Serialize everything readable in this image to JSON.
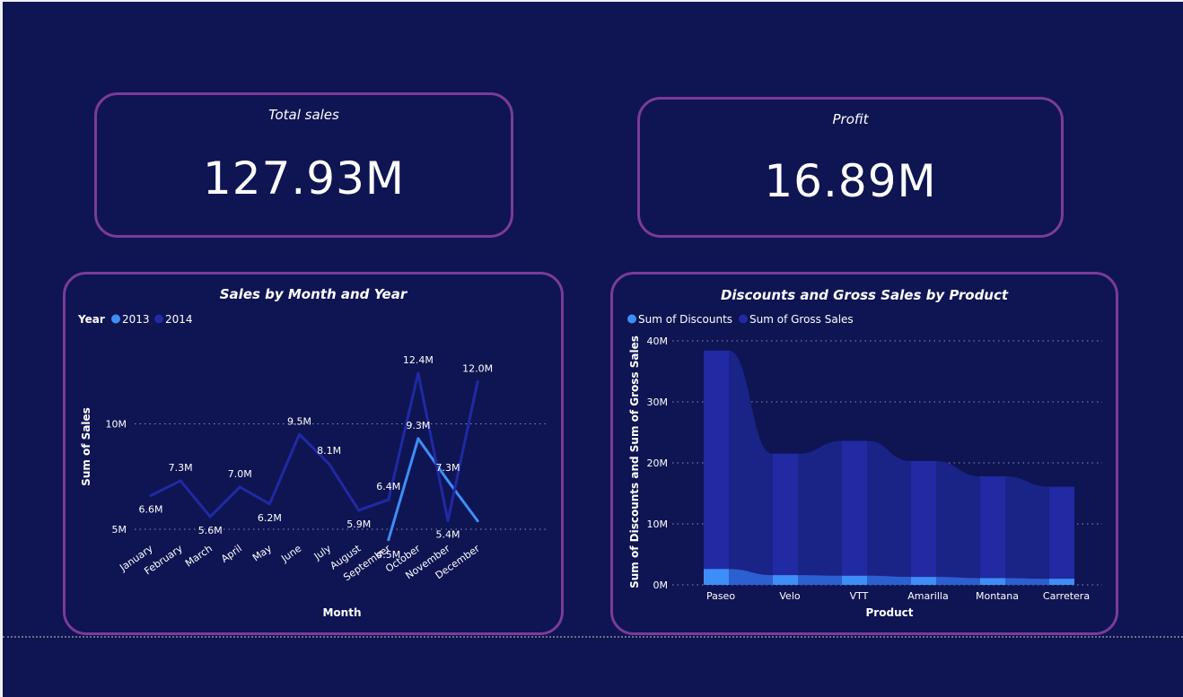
{
  "kpis": {
    "total_sales": {
      "title": "Total sales",
      "value": "127.93M"
    },
    "profit": {
      "title": "Profit",
      "value": "16.89M"
    }
  },
  "colors": {
    "background": "#0e1552",
    "card_border": "#7b3b98",
    "series_2013": "#3e8ef7",
    "series_2014": "#2129a3",
    "series_discounts": "#3e8ef7",
    "series_gross_sales": "#2129a3"
  },
  "chart_data": [
    {
      "type": "line",
      "title": "Sales by Month and Year",
      "legend_title": "Year",
      "legend_position": "top-left",
      "xlabel": "Month",
      "ylabel": "Sum of Sales",
      "yticks": [
        "5M",
        "10M"
      ],
      "categories": [
        "January",
        "February",
        "March",
        "April",
        "May",
        "June",
        "July",
        "August",
        "September",
        "October",
        "November",
        "December"
      ],
      "series": [
        {
          "name": "2013",
          "values": [
            null,
            null,
            null,
            null,
            null,
            null,
            null,
            null,
            4.5,
            9.3,
            7.3,
            5.4
          ],
          "labels": [
            "",
            "",
            "",
            "",
            "",
            "",
            "",
            "",
            "4.5M",
            "9.3M",
            "7.3M",
            ""
          ]
        },
        {
          "name": "2014",
          "values": [
            6.6,
            7.3,
            5.6,
            7.0,
            6.2,
            9.5,
            8.1,
            5.9,
            6.4,
            12.4,
            5.4,
            12.0
          ],
          "labels": [
            "6.6M",
            "7.3M",
            "5.6M",
            "7.0M",
            "6.2M",
            "9.5M",
            "8.1M",
            "5.9M",
            "6.4M",
            "12.4M",
            "5.4M",
            "12.0M"
          ]
        }
      ],
      "grid": true
    },
    {
      "type": "area",
      "title": "Discounts and Gross Sales by Product",
      "legend_position": "top-left",
      "xlabel": "Product",
      "ylabel": "Sum of Discounts and Sum of Gross Sales",
      "yticks": [
        "0M",
        "10M",
        "20M",
        "30M",
        "40M"
      ],
      "ylim": [
        0,
        40
      ],
      "categories": [
        "Paseo",
        "Velo",
        "VTT",
        "Amarilla",
        "Montana",
        "Carretera"
      ],
      "series": [
        {
          "name": "Sum of Discounts",
          "values": [
            2.6,
            1.6,
            1.5,
            1.3,
            1.1,
            1.0
          ]
        },
        {
          "name": "Sum of Gross Sales",
          "values": [
            38.4,
            21.5,
            23.6,
            20.3,
            17.8,
            16.1
          ]
        }
      ],
      "grid": true
    }
  ]
}
